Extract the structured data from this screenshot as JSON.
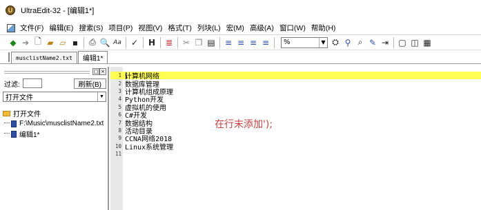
{
  "window": {
    "title": "UltraEdit-32 - [编辑1*]"
  },
  "menu": [
    {
      "label": "文件(F)"
    },
    {
      "label": "编辑(E)"
    },
    {
      "label": "搜索(S)"
    },
    {
      "label": "项目(P)"
    },
    {
      "label": "视图(V)"
    },
    {
      "label": "格式(T)"
    },
    {
      "label": "列块(L)"
    },
    {
      "label": "宏(M)"
    },
    {
      "label": "高级(A)"
    },
    {
      "label": "窗口(W)"
    },
    {
      "label": "帮助(H)"
    }
  ],
  "toolbar": {
    "combo_value": "%"
  },
  "tabs": [
    {
      "label": "musclistName2.txt"
    },
    {
      "label": "编辑1*"
    }
  ],
  "sidebar": {
    "filter_label": "过滤:",
    "refresh_label": "刷新(B)",
    "select_value": "打开文件",
    "tree": [
      {
        "label": "打开文件"
      },
      {
        "label": "F:\\Music\\musclistName2.txt"
      },
      {
        "label": "编辑1*"
      }
    ]
  },
  "editor": {
    "lines": [
      {
        "num": "1",
        "text": "计算机网络"
      },
      {
        "num": "2",
        "text": "数据库管理"
      },
      {
        "num": "3",
        "text": "计算机组成原理"
      },
      {
        "num": "4",
        "text": "Python开发"
      },
      {
        "num": "5",
        "text": "虚拟机的使用"
      },
      {
        "num": "6",
        "text": "C#开发"
      },
      {
        "num": "7",
        "text": "数据结构"
      },
      {
        "num": "8",
        "text": "活动目录"
      },
      {
        "num": "9",
        "text": "CCNA网络2018"
      },
      {
        "num": "10",
        "text": "Linux系统管理"
      },
      {
        "num": "11",
        "text": ""
      }
    ],
    "annotation": "在行末添加');"
  },
  "colors": {
    "highlight": "#ffff54",
    "annotation": "#d03c3c"
  }
}
